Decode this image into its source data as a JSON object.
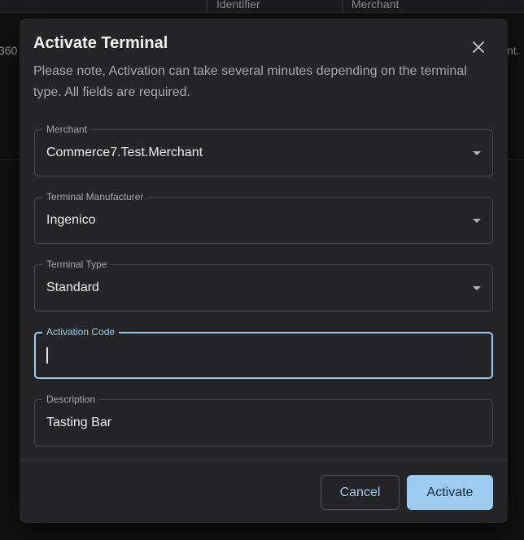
{
  "background": {
    "columns": [
      "Identifier",
      "Merchant"
    ],
    "row_fragment_left": "360",
    "row_fragment_right": "nt."
  },
  "dialog": {
    "title": "Activate Terminal",
    "subtitle": "Please note, Activation can take several minutes depending on the terminal type. All fields are required.",
    "close_icon": "close-icon",
    "fields": {
      "merchant": {
        "label": "Merchant",
        "value": "Commerce7.Test.Merchant"
      },
      "manufacturer": {
        "label": "Terminal Manufacturer",
        "value": "Ingenico"
      },
      "type": {
        "label": "Terminal Type",
        "value": "Standard"
      },
      "activation_code": {
        "label": "Activation Code",
        "value": ""
      },
      "description": {
        "label": "Description",
        "value": "Tasting Bar"
      }
    },
    "buttons": {
      "cancel": "Cancel",
      "activate": "Activate"
    },
    "colors": {
      "accent": "#9ccbef",
      "surface": "#252527"
    }
  }
}
